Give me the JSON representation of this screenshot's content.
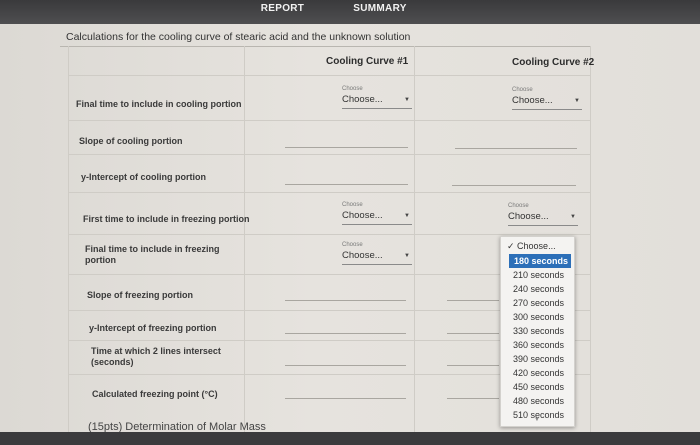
{
  "tabs": [
    {
      "label": "REPORT",
      "active": true
    },
    {
      "label": "SUMMARY",
      "active": false
    }
  ],
  "section_title": "Calculations for the cooling curve of stearic acid and the unknown solution",
  "columns": [
    "Cooling Curve #1",
    "Cooling Curve #2"
  ],
  "rows": {
    "final_cooling": "Final time to include in cooling portion",
    "slope_cooling": "Slope of cooling portion",
    "yint_cooling": "y-Intercept of cooling portion",
    "first_freezing": "First time to include in freezing portion",
    "final_freezing": "Final time to include in freezing portion",
    "slope_freezing": "Slope of freezing portion",
    "yint_freezing": "y-Intercept of freezing portion",
    "intersect": "Time at which 2 lines intersect (seconds)",
    "freezing_point": "Calculated freezing point (°C)"
  },
  "select": {
    "mini_label": "Choose",
    "value": "Choose..."
  },
  "dropdown": {
    "checked_option": "✓ Choose...",
    "highlighted": "180 seconds",
    "options": [
      "210 seconds",
      "240 seconds",
      "270 seconds",
      "300 seconds",
      "330 seconds",
      "360 seconds",
      "390 seconds",
      "420 seconds",
      "450 seconds",
      "480 seconds",
      "510 seconds"
    ]
  },
  "footer_title": "(15pts) Determination of Molar Mass",
  "icons": {
    "caret": "▼",
    "scroll_down": "▼"
  },
  "colors": {
    "highlight": "#2c6fb8",
    "topbar": "#3a3a3c"
  }
}
